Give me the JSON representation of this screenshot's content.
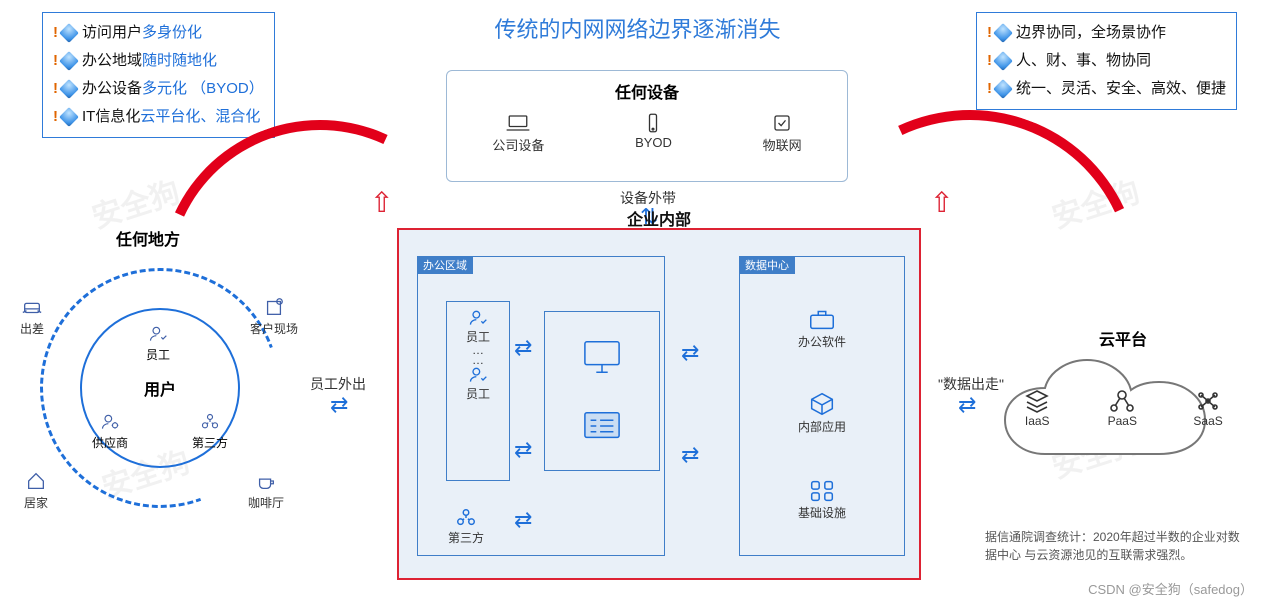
{
  "title": "传统的内网网络边界逐渐消失",
  "left_box": [
    {
      "black": "访问用户",
      "blue": "多身份化"
    },
    {
      "black": "办公地域",
      "blue": "随时随地化"
    },
    {
      "black": "办公设备",
      "blue": "多元化 （BYOD）"
    },
    {
      "black": "IT信息化",
      "blue": "云平台化、混合化"
    }
  ],
  "right_box": [
    {
      "black": "边界协同，全场景协作",
      "blue": ""
    },
    {
      "black": "人、财、事、物协同",
      "blue": ""
    },
    {
      "black": "统一、灵活、安全、高效、便捷",
      "blue": ""
    }
  ],
  "devices": {
    "header": "任何设备",
    "items": [
      "公司设备",
      "BYOD",
      "物联网"
    ]
  },
  "labels": {
    "device_out": "设备外带",
    "employee_out": "员工外出",
    "data_out": "\"数据出走\"",
    "enterprise": "企业内部",
    "office_area": "办公区域",
    "data_center": "数据中心",
    "anywhere": "任何地方",
    "user_center": "用户",
    "cloud": "云平台"
  },
  "emp_stack": {
    "top": "员工",
    "bottom": "员工"
  },
  "third_party": "第三方",
  "data_center_items": [
    "办公软件",
    "内部应用",
    "基础设施"
  ],
  "anywhere_outer": [
    {
      "key": "travel",
      "label": "出差"
    },
    {
      "key": "client",
      "label": "客户现场"
    },
    {
      "key": "home",
      "label": "居家"
    },
    {
      "key": "cafe",
      "label": "咖啡厅"
    }
  ],
  "anywhere_inner": [
    {
      "key": "employee",
      "label": "员工"
    },
    {
      "key": "supplier",
      "label": "供应商"
    },
    {
      "key": "third",
      "label": "第三方"
    }
  ],
  "cloud_items": [
    "IaaS",
    "PaaS",
    "SaaS"
  ],
  "footnote": "据信通院调查统计：2020年超过半数的企业对数据中心 与云资源池见的互联需求强烈。",
  "credit": "CSDN @安全狗（safedog）",
  "watermark": "安全狗"
}
